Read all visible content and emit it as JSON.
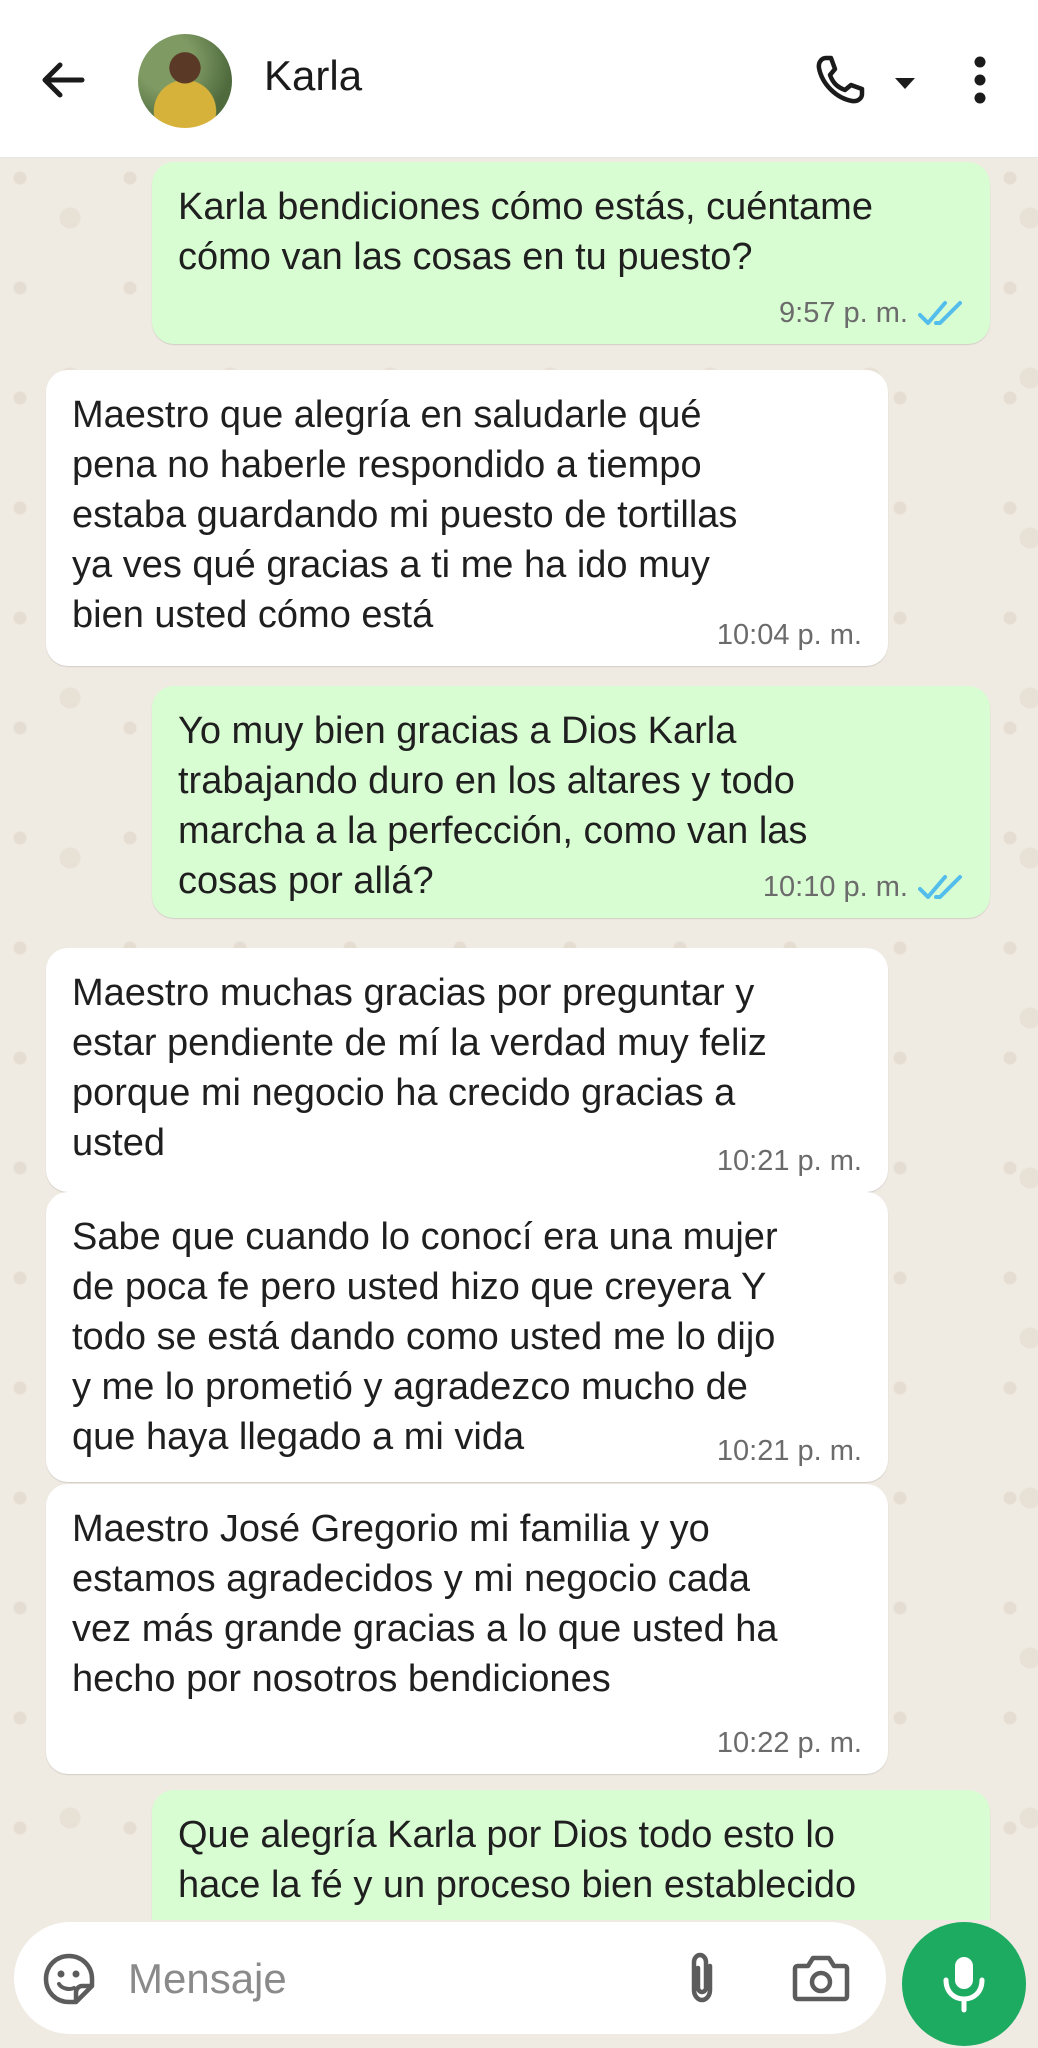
{
  "header": {
    "contact_name": "Karla",
    "icons": [
      "back-arrow-icon",
      "avatar",
      "phone-icon",
      "caret-down-icon",
      "more-vert-icon"
    ]
  },
  "messages": [
    {
      "direction": "out",
      "text": "Karla bendiciones cómo estás, cuéntame\ncómo van las cosas en tu puesto?",
      "time": "9:57 p. m.",
      "status": "read"
    },
    {
      "direction": "in",
      "text": "Maestro que alegría en saludarle qué\npena no haberle respondido a tiempo\nestaba guardando mi puesto de tortillas\nya ves qué gracias a ti me ha ido muy\nbien usted cómo está",
      "time": "10:04 p. m."
    },
    {
      "direction": "out",
      "text": "Yo muy bien gracias a Dios Karla\ntrabajando duro en los altares y todo\nmarcha a la perfección, como van las\ncosas por allá?",
      "time": "10:10 p. m.",
      "status": "read"
    },
    {
      "direction": "in",
      "text": "Maestro muchas gracias por preguntar y\nestar pendiente de mí la verdad muy feliz\nporque mi negocio ha crecido gracias a\nusted",
      "time": "10:21 p. m."
    },
    {
      "direction": "in",
      "text": "Sabe que cuando lo conocí era una mujer\nde poca fe pero usted hizo que creyera Y\ntodo se está dando como usted me lo dijo\ny me lo prometió y agradezco mucho de\nque haya llegado a mi vida",
      "time": "10:21 p. m."
    },
    {
      "direction": "in",
      "text": "Maestro José Gregorio mi familia y yo\nestamos agradecidos y mi negocio cada\nvez más grande gracias a lo que usted ha\nhecho por nosotros bendiciones",
      "time": "10:22 p. m."
    },
    {
      "direction": "out",
      "text": "Que alegría Karla por Dios todo esto lo\nhace la fé y un proceso bien establecido",
      "time": "",
      "status": ""
    }
  ],
  "composer": {
    "placeholder": "Mensaje",
    "icons": [
      "sticker-icon",
      "paperclip-icon",
      "camera-icon",
      "mic-icon"
    ]
  },
  "colors": {
    "outgoing_bubble": "#d9fdd3",
    "incoming_bubble": "#ffffff",
    "read_ticks": "#53bdeb",
    "mic_button": "#1daa61",
    "chat_background": "#efeae2"
  }
}
